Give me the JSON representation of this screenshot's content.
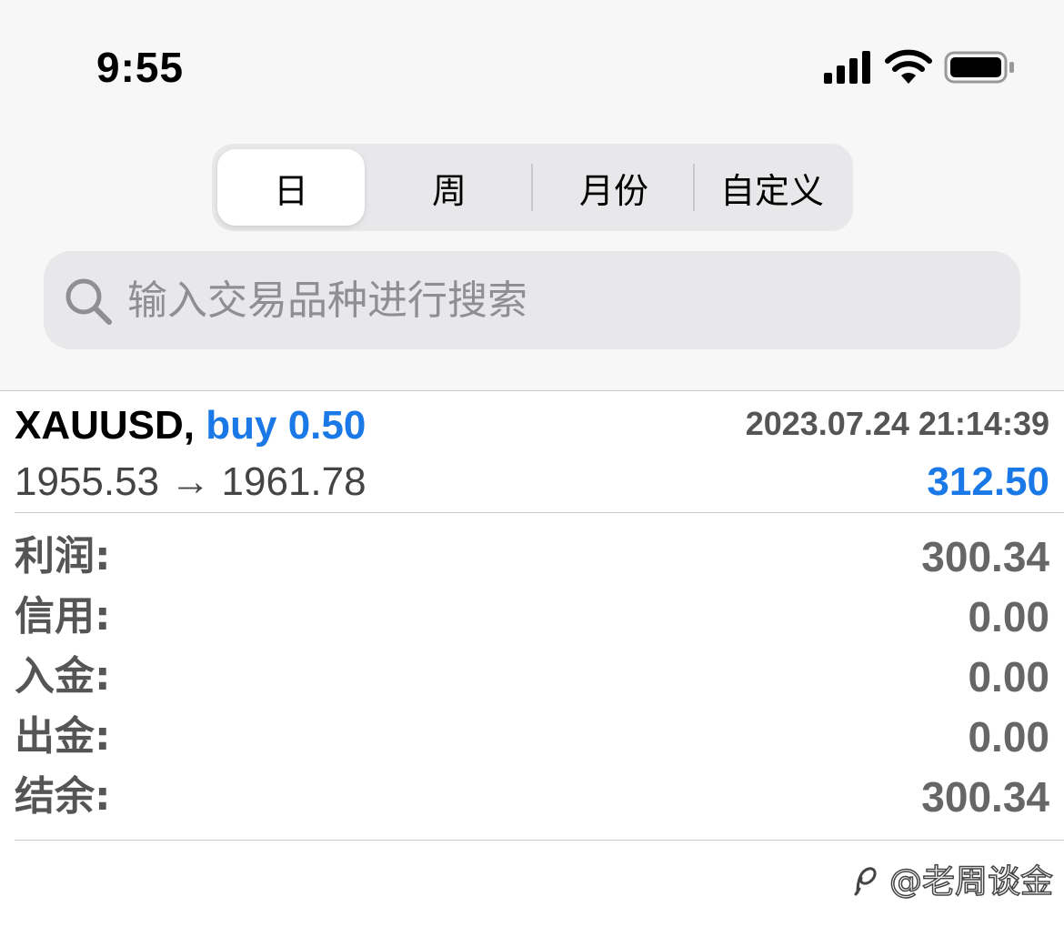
{
  "status_bar": {
    "time": "9:55"
  },
  "segmented_control": {
    "selected": "日",
    "items": [
      "日",
      "周",
      "月份",
      "自定义"
    ]
  },
  "search": {
    "placeholder": "输入交易品种进行搜索",
    "value": ""
  },
  "trade": {
    "symbol": "XAUUSD,",
    "direction": "buy 0.50",
    "datetime": "2023.07.24 21:14:39",
    "open_price": "1955.53",
    "arrow": "→",
    "close_price": "1961.78",
    "profit": "312.50"
  },
  "summary": [
    {
      "label": "利润:",
      "value": "300.34"
    },
    {
      "label": "信用:",
      "value": "0.00"
    },
    {
      "label": "入金:",
      "value": "0.00"
    },
    {
      "label": "出金:",
      "value": "0.00"
    },
    {
      "label": "结余:",
      "value": "300.34"
    }
  ],
  "watermark": "@老周谈金",
  "colors": {
    "accent_blue": "#1a79e6",
    "label_gray": "#555555",
    "value_gray": "#666666",
    "background_top": "#f7f7f7",
    "control_gray": "#e8e8ea"
  },
  "icons": {
    "status": [
      "signal-icon",
      "wifi-icon",
      "battery-icon"
    ],
    "search": "search-icon",
    "watermark": "weibo-logo-icon"
  }
}
